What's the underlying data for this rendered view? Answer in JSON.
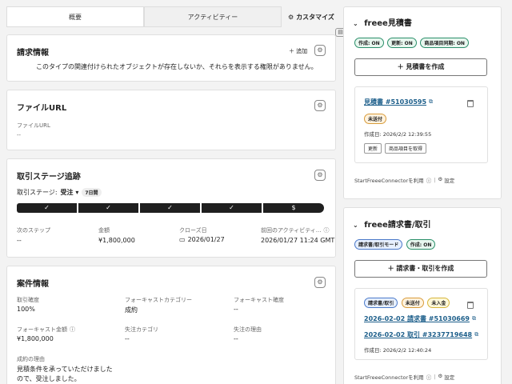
{
  "tabs": [
    {
      "label": "概要"
    },
    {
      "label": "アクティビティー"
    }
  ],
  "customize_label": "カスタマイズ",
  "invoice_info": {
    "title": "請求情報",
    "add_label": "＋ 追加",
    "empty_message": "このタイプの関連付けられたオブジェクトが存在しないか、それらを表示する権限がありません。"
  },
  "file_url": {
    "title": "ファイルURL",
    "field_label": "ファイルURL",
    "field_value": "--"
  },
  "stage_tracking": {
    "title": "取引ステージ追跡",
    "stage_label": "取引ステージ:",
    "stage_value": "受注",
    "days_badge": "7日間",
    "steps": [
      "✓",
      "✓",
      "✓",
      "✓",
      "$"
    ],
    "fields": [
      {
        "label": "次のステップ",
        "value": "--"
      },
      {
        "label": "金額",
        "value": "¥1,800,000"
      },
      {
        "label": "クローズ日",
        "value": "2026/01/27"
      },
      {
        "label": "前回のアクティビティ...",
        "value": "2026/01/27 11:24 GMT"
      }
    ]
  },
  "deal_info": {
    "title": "案件情報",
    "fields": [
      {
        "label": "取引確度",
        "value": "100%"
      },
      {
        "label": "フォーキャストカテゴリー",
        "value": "成約"
      },
      {
        "label": "フォーキャスト確度",
        "value": "--"
      },
      {
        "label": "フォーキャスト金額",
        "value": "¥1,800,000"
      },
      {
        "label": "失注カテゴリ",
        "value": "--"
      },
      {
        "label": "失注の理由",
        "value": "--"
      }
    ],
    "reason_label": "成約の理由",
    "reason_line1": "見積条件を承っていただけました",
    "reason_line2": "ので、受注しました。"
  },
  "quote_panel": {
    "title": "freee見積書",
    "pills": [
      "作成: ON",
      "更新: ON",
      "商品項目同期: ON"
    ],
    "create_button": "＋ 見積書を作成",
    "item_link": "見積書 #51030595",
    "status_pill": "未送付",
    "created": "作成日: 2026/2/2 12:39:55",
    "update_button": "更新",
    "fetch_button": "商品項目を取得",
    "footer": "StartFreeeConnectorを利用",
    "settings": "設定"
  },
  "invoice_panel": {
    "title": "freee請求書/取引",
    "mode_pill": "請求書/取引モード",
    "create_pill": "作成: ON",
    "create_button": "＋ 請求書・取引を作成",
    "status_pills": [
      "請求書/取引",
      "未送付",
      "未入金"
    ],
    "link1": "2026-02-02 請求書 #51030669",
    "link2": "2026-02-02 取引 #3237719648",
    "created": "作成日: 2026/2/2 12:40:24",
    "footer": "StartFreeeConnectorを利用",
    "settings": "設定"
  }
}
